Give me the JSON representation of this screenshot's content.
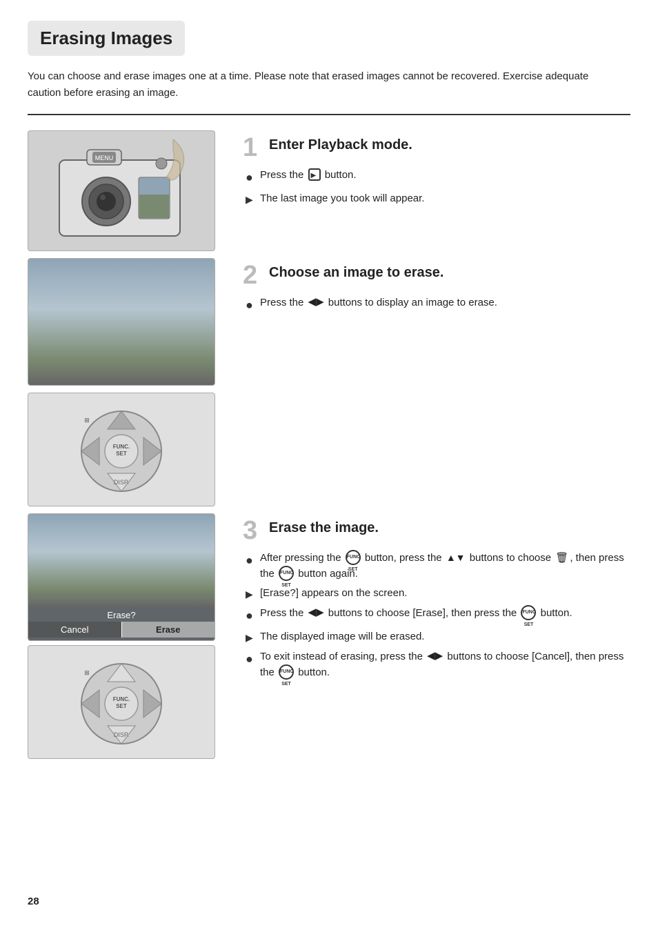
{
  "page": {
    "title": "Erasing Images",
    "page_number": "28",
    "intro": "You can choose and erase images one at a time. Please note that erased images cannot be recovered. Exercise adequate caution before erasing an image."
  },
  "steps": [
    {
      "number": "1",
      "title": "Enter Playback mode.",
      "bullets": [
        {
          "type": "dot",
          "text_before": "Press the",
          "icon": "playback-button-icon",
          "text_after": "button."
        },
        {
          "type": "arrow",
          "text": "The last image you took will appear."
        }
      ]
    },
    {
      "number": "2",
      "title": "Choose an image to erase.",
      "bullets": [
        {
          "type": "dot",
          "text_before": "Press the",
          "icon": "lr-buttons-icon",
          "text_after": "buttons to display an image to erase."
        }
      ]
    },
    {
      "number": "3",
      "title": "Erase the image.",
      "bullets": [
        {
          "type": "dot",
          "text_before": "After pressing the",
          "icon": "func-set-icon",
          "text_middle": "button, press the",
          "icon2": "updown-icon",
          "text_middle2": "buttons to choose",
          "icon3": "trash-icon",
          "text_after": ", then press the",
          "icon4": "func-set-icon2",
          "text_end": "button again."
        },
        {
          "type": "arrow",
          "text": "[Erase?] appears on the screen."
        },
        {
          "type": "dot",
          "text_before": "Press the",
          "icon": "lr-buttons-icon2",
          "text_middle": "buttons to choose [Erase], then press the",
          "icon2": "func-set-icon3",
          "text_after": "button."
        },
        {
          "type": "arrow",
          "text": "The displayed image will be erased."
        },
        {
          "type": "dot",
          "text_before": "To exit instead of erasing, press the",
          "icon": "lr-buttons-icon3",
          "text_middle": "buttons to choose [Cancel], then press the",
          "icon2": "func-set-icon4",
          "text_after": "button."
        }
      ]
    }
  ],
  "erase_dialog": {
    "label": "Erase?",
    "cancel": "Cancel",
    "erase": "Erase"
  }
}
